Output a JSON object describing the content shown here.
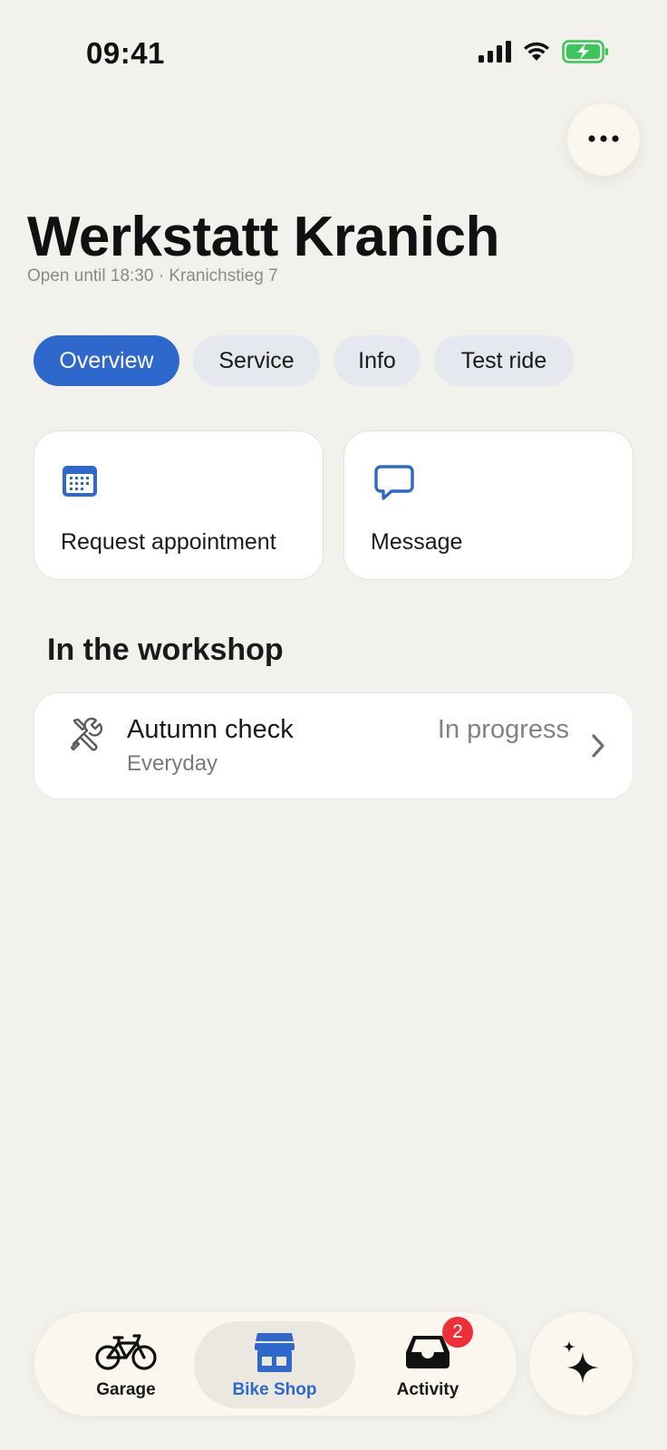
{
  "status_bar": {
    "time": "09:41",
    "icons": [
      "signal-icon",
      "wifi-icon",
      "battery-charging-icon"
    ],
    "battery_color": "#3cc65a"
  },
  "header": {
    "more_icon": "ellipsis-icon",
    "title": "Werkstatt Kranich",
    "subtitle": "Open until 18:30 · Kranichstieg 7"
  },
  "tabs": [
    {
      "label": "Overview",
      "active": true
    },
    {
      "label": "Service",
      "active": false
    },
    {
      "label": "Info",
      "active": false
    },
    {
      "label": "Test ride",
      "active": false
    }
  ],
  "actions": [
    {
      "label": "Request appointment",
      "icon": "calendar-icon"
    },
    {
      "label": "Message",
      "icon": "chat-bubble-icon"
    }
  ],
  "workshop": {
    "heading": "In the workshop",
    "item": {
      "title": "Autumn check",
      "subtitle": "Everyday",
      "status": "In progress",
      "icon": "tools-icon"
    }
  },
  "tab_bar": {
    "items": [
      {
        "label": "Garage",
        "icon": "bicycle-icon",
        "selected": false
      },
      {
        "label": "Bike Shop",
        "icon": "storefront-icon",
        "selected": true
      },
      {
        "label": "Activity",
        "icon": "inbox-icon",
        "selected": false,
        "badge": "2"
      }
    ],
    "sparkle_icon": "sparkle-icon"
  },
  "colors": {
    "accent": "#2f68cc",
    "background": "#f3f1eb",
    "badge": "#ef2f38"
  }
}
